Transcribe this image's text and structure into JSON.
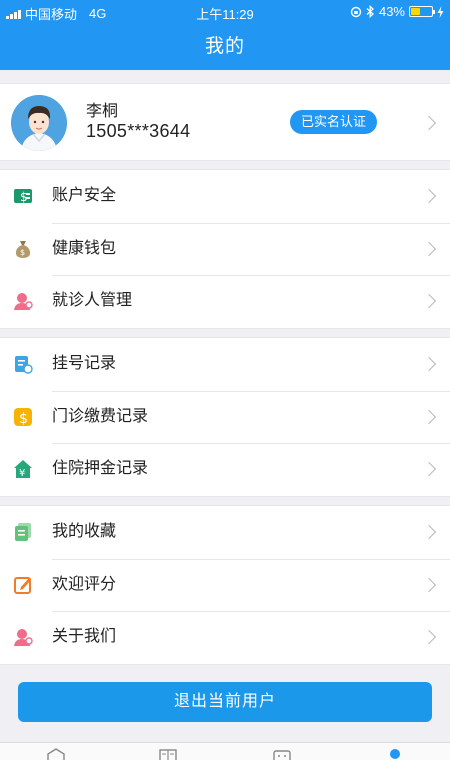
{
  "status_bar": {
    "carrier": "中国移动",
    "network": "4G",
    "time": "上午11:29",
    "battery": "43%",
    "battery_level": 0.43,
    "battery_color": "#ffd600"
  },
  "nav": {
    "title": "我的"
  },
  "profile": {
    "name": "李桐",
    "phone": "1505***3644",
    "badge": "已实名认证"
  },
  "groups": [
    [
      {
        "label": "账户安全",
        "icon": "account-security-icon",
        "color": "#1a9a6c"
      },
      {
        "label": "健康钱包",
        "icon": "money-bag-icon",
        "color": "#b29b6a"
      },
      {
        "label": "就诊人管理",
        "icon": "patient-icon",
        "color": "#ef6d8a"
      }
    ],
    [
      {
        "label": "挂号记录",
        "icon": "registration-record-icon",
        "color": "#3aa6e8"
      },
      {
        "label": "门诊缴费记录",
        "icon": "payment-coin-icon",
        "color": "#f5b400"
      },
      {
        "label": "住院押金记录",
        "icon": "hospital-deposit-icon",
        "color": "#27a87a"
      }
    ],
    [
      {
        "label": "我的收藏",
        "icon": "favorites-icon",
        "color": "#62c27c"
      },
      {
        "label": "欢迎评分",
        "icon": "rating-edit-icon",
        "color": "#f07b2a"
      },
      {
        "label": "关于我们",
        "icon": "about-us-icon",
        "color": "#ef6d8a"
      }
    ]
  ],
  "logout_label": "退出当前用户",
  "colors": {
    "primary": "#2196f3",
    "background": "#efeff4"
  }
}
